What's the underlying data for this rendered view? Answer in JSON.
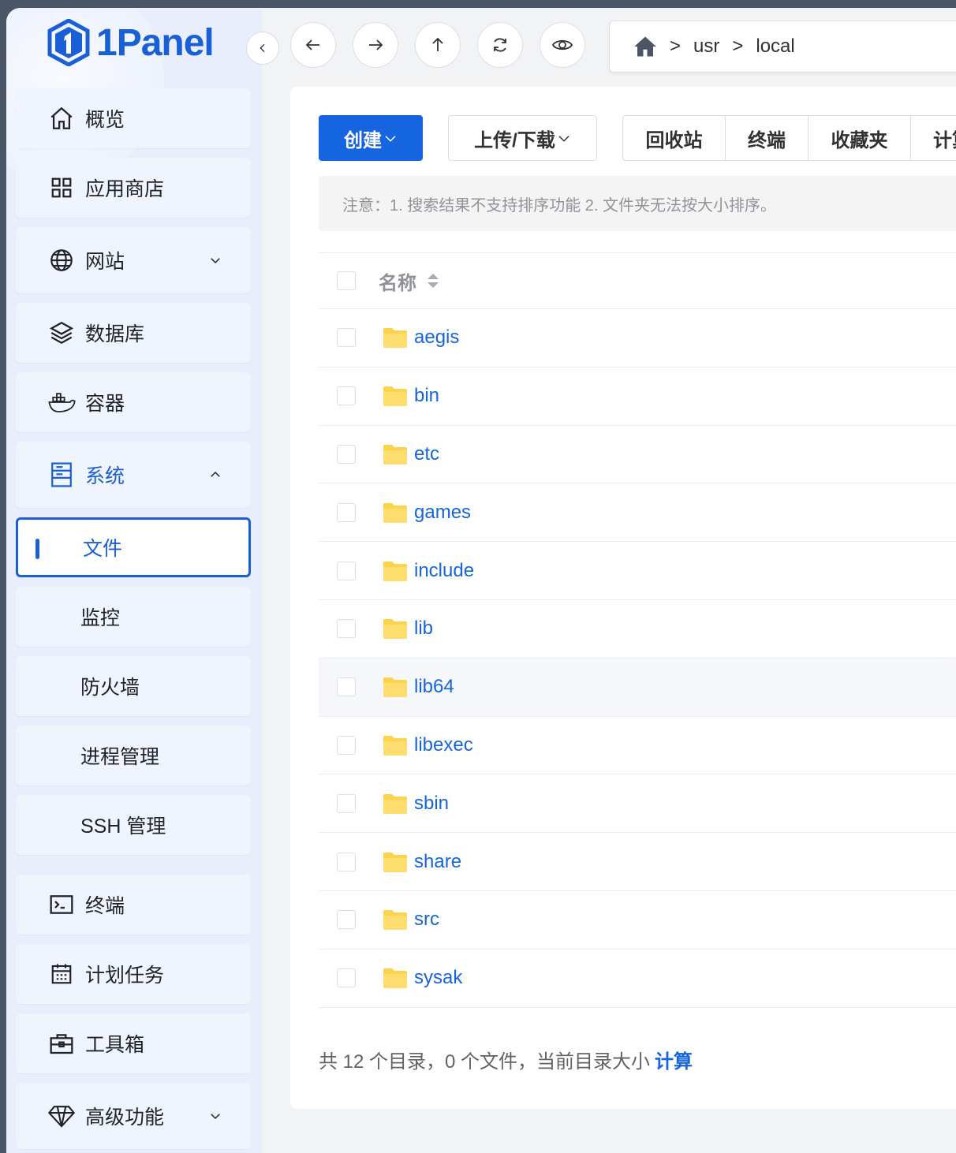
{
  "logo": {
    "text": "1Panel"
  },
  "sidebar": {
    "items": [
      {
        "label": "概览",
        "icon": "home-icon"
      },
      {
        "label": "应用商店",
        "icon": "grid-icon"
      },
      {
        "label": "网站",
        "icon": "globe-icon",
        "expandable": true
      },
      {
        "label": "数据库",
        "icon": "layers-icon"
      },
      {
        "label": "容器",
        "icon": "docker-icon"
      },
      {
        "label": "系统",
        "icon": "server-icon",
        "expanded": true
      },
      {
        "label": "文件",
        "sub": true,
        "active": true
      },
      {
        "label": "监控",
        "sub": true
      },
      {
        "label": "防火墙",
        "sub": true
      },
      {
        "label": "进程管理",
        "sub": true
      },
      {
        "label": "SSH 管理",
        "sub": true
      },
      {
        "label": "终端",
        "icon": "terminal-icon"
      },
      {
        "label": "计划任务",
        "icon": "calendar-icon"
      },
      {
        "label": "工具箱",
        "icon": "toolbox-icon"
      },
      {
        "label": "高级功能",
        "icon": "diamond-icon",
        "expandable": true
      }
    ]
  },
  "breadcrumb": {
    "parts": [
      "usr",
      "local"
    ],
    "separator": ">"
  },
  "toolbar": {
    "create_label": "创建",
    "upload_label": "上传/下载",
    "group": [
      "回收站",
      "终端",
      "收藏夹",
      "计算"
    ]
  },
  "notice": "注意：1. 搜索结果不支持排序功能 2. 文件夹无法按大小排序。",
  "table": {
    "header_name": "名称",
    "rows": [
      "aegis",
      "bin",
      "etc",
      "games",
      "include",
      "lib",
      "lib64",
      "libexec",
      "sbin",
      "share",
      "src",
      "sysak"
    ]
  },
  "footer": {
    "summary": "共 12 个目录，0 个文件，当前目录大小",
    "calc_label": "计算"
  },
  "colors": {
    "accent": "#1565e0",
    "folder": "#fcd34d",
    "sidebar_bg": "#e8eefb"
  }
}
